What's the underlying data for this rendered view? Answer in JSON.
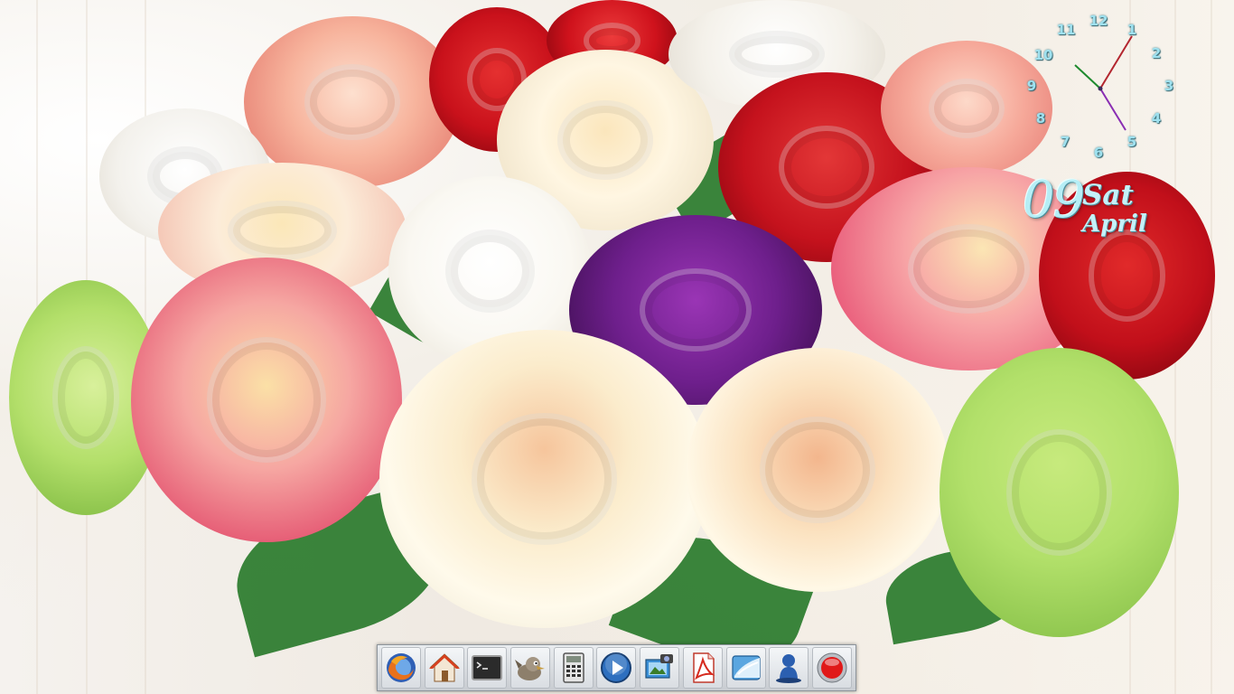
{
  "clock": {
    "numbers": [
      "12",
      "1",
      "2",
      "3",
      "4",
      "5",
      "6",
      "7",
      "8",
      "9",
      "10",
      "11"
    ]
  },
  "date": {
    "day": "09",
    "weekday": "Sat",
    "month": "April"
  },
  "dock": {
    "items": [
      {
        "icon": "firefox-icon"
      },
      {
        "icon": "home-folder-icon"
      },
      {
        "icon": "terminal-icon"
      },
      {
        "icon": "gimp-icon"
      },
      {
        "icon": "calculator-icon"
      },
      {
        "icon": "media-player-icon"
      },
      {
        "icon": "screenshot-icon"
      },
      {
        "icon": "pdf-viewer-icon"
      },
      {
        "icon": "file-manager-icon"
      },
      {
        "icon": "user-accounts-icon"
      },
      {
        "icon": "power-record-icon"
      }
    ]
  }
}
